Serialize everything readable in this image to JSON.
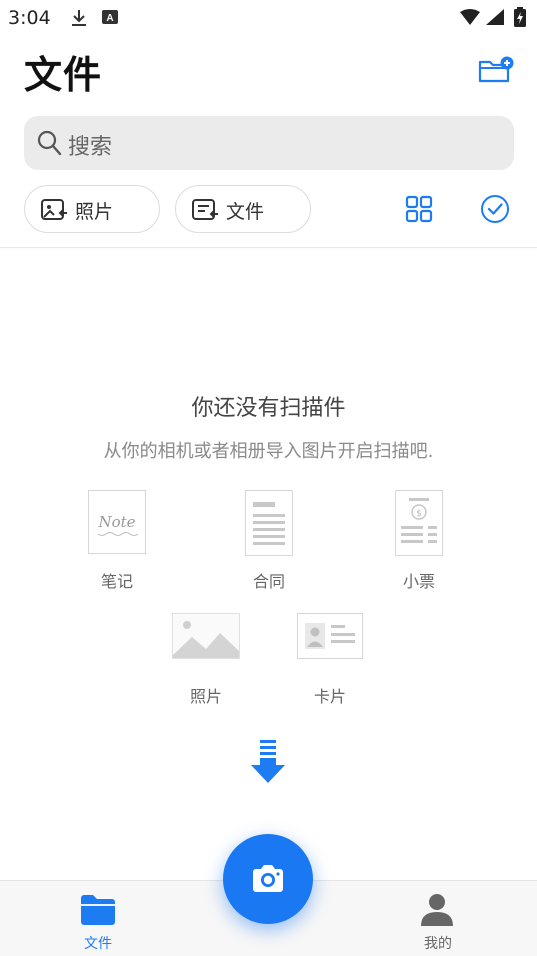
{
  "status_bar": {
    "time": "3:04",
    "icons": [
      "download-icon",
      "a-badge-icon",
      "wifi-icon",
      "signal-icon",
      "battery-charging-icon"
    ]
  },
  "header": {
    "title": "文件",
    "new_folder_icon": "folder-plus-icon"
  },
  "search": {
    "placeholder": "搜索",
    "icon": "search-icon"
  },
  "filters": {
    "chips": [
      {
        "label": "照片",
        "icon": "photo-import-icon"
      },
      {
        "label": "文件",
        "icon": "file-import-icon"
      }
    ],
    "view_toggle_icon": "grid-view-icon",
    "select_icon": "check-circle-icon"
  },
  "empty_state": {
    "title": "你还没有扫描件",
    "subtitle": "从你的相机或者相册导入图片开启扫描吧.",
    "types": [
      {
        "label": "笔记",
        "thumb_text": "Note"
      },
      {
        "label": "合同"
      },
      {
        "label": "小票"
      },
      {
        "label": "照片"
      },
      {
        "label": "卡片"
      }
    ],
    "arrow_icon": "arrow-down-icon"
  },
  "camera_button_icon": "camera-icon",
  "bottom_nav": {
    "items": [
      {
        "label": "文件",
        "icon": "folder-icon",
        "active": true
      },
      {
        "label": "我的",
        "icon": "person-icon",
        "active": false
      }
    ]
  },
  "colors": {
    "accent": "#1e7cf2",
    "search_bg": "#ebebeb",
    "nav_bg": "#f7f7f7"
  }
}
